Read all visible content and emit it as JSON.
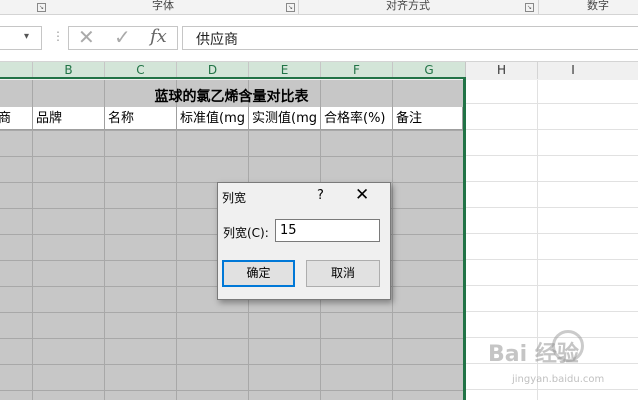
{
  "ribbon": {
    "groups": [
      {
        "label": "字体"
      },
      {
        "label": "对齐方式"
      },
      {
        "label": "数字"
      }
    ]
  },
  "formula_bar": {
    "name_box": "",
    "formula": "供应商"
  },
  "columns": {
    "selected": [
      "B",
      "C",
      "D",
      "E",
      "F",
      "G"
    ],
    "unselected": [
      "H",
      "I"
    ]
  },
  "sheet": {
    "title": "蓝球的氯乙烯含量对比表",
    "headers": [
      "商",
      "品牌",
      "名称",
      "标准值(mg",
      "实测值(mg",
      "合格率(%)",
      "备注"
    ]
  },
  "dialog": {
    "title": "列宽",
    "help": "?",
    "close": "✕",
    "field_label": "列宽(C):",
    "field_value": "15",
    "ok_label": "确定",
    "cancel_label": "取消"
  },
  "watermark": {
    "text": "Bai 经验",
    "sub": "jingyan.baidu.com"
  },
  "colors": {
    "excel_green": "#217346",
    "selection_gray": "#c7c7c7",
    "dialog_focus": "#0078d7"
  }
}
